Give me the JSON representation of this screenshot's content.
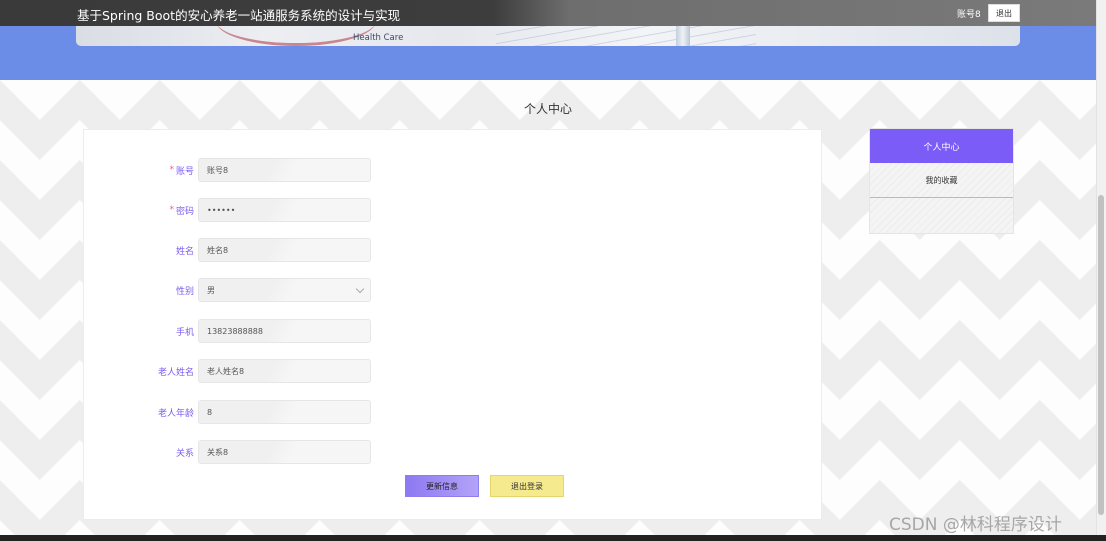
{
  "header": {
    "title": "基于Spring Boot的安心养老一站通服务系统的设计与实现",
    "username": "账号8",
    "logout_label": "退出"
  },
  "banner": {
    "caption": "Health Care"
  },
  "page": {
    "title": "个人中心"
  },
  "form": {
    "fields": [
      {
        "label": "账号",
        "required": true,
        "value": "账号8"
      },
      {
        "label": "密码",
        "required": true,
        "value": "••••••"
      },
      {
        "label": "姓名",
        "required": false,
        "value": "姓名8"
      },
      {
        "label": "性别",
        "required": false,
        "value": "男"
      },
      {
        "label": "手机",
        "required": false,
        "value": "13823888888"
      },
      {
        "label": "老人姓名",
        "required": false,
        "value": "老人姓名8"
      },
      {
        "label": "老人年龄",
        "required": false,
        "value": "8"
      },
      {
        "label": "关系",
        "required": false,
        "value": "关系8"
      }
    ],
    "required_mark": "*",
    "update_button": "更新信息",
    "logout_button": "退出登录"
  },
  "sidebar": {
    "items": [
      {
        "label": "个人中心",
        "active": true
      },
      {
        "label": "我的收藏",
        "active": false
      }
    ]
  },
  "watermark": "CSDN @林科程序设计",
  "colors": {
    "accent": "#7c5cf6",
    "banner": "#6b8de8",
    "label": "#7a5cf0",
    "required": "#f0569a",
    "logout_button": "#f6ea8e"
  }
}
